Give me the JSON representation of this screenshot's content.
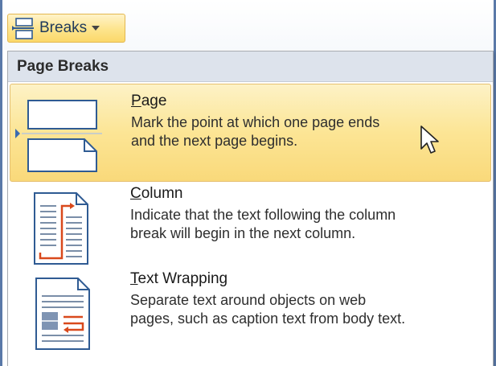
{
  "toolbar": {
    "breaks_label": "Breaks",
    "breaks_icon": "page-breaks-icon",
    "dropdown_icon": "chevron-down-icon"
  },
  "menu": {
    "section_header": "Page Breaks",
    "items": [
      {
        "title_accel": "P",
        "title_rest": "age",
        "description_line1": "Mark the point at which one page ends",
        "description_line2": "and the next page begins.",
        "icon": "page-break-icon",
        "highlighted": true
      },
      {
        "title_accel": "C",
        "title_rest": "olumn",
        "description_line1": "Indicate that the text following the column",
        "description_line2": "break will begin in the next column.",
        "icon": "column-break-icon",
        "highlighted": false
      },
      {
        "title_accel": "T",
        "title_rest": "ext Wrapping",
        "description_line1": "Separate text around objects on web",
        "description_line2": "pages, such as caption text from body text.",
        "icon": "text-wrapping-break-icon",
        "highlighted": false
      }
    ]
  },
  "colors": {
    "hover_fill": "#fce595",
    "hover_border": "#e6c070",
    "header_fill": "#dde3ec",
    "frame_border": "#5a79a8",
    "accent_red": "#d9491c"
  }
}
